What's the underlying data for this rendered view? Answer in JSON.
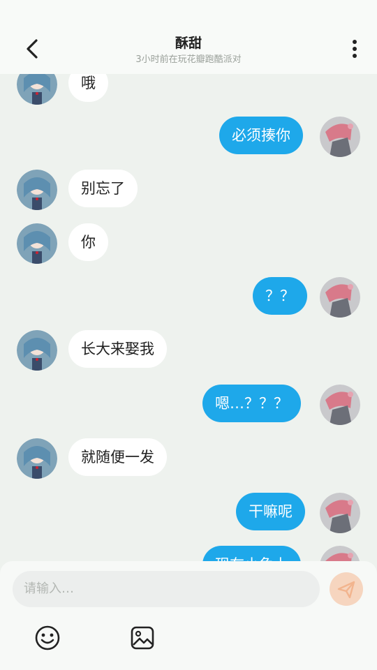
{
  "header": {
    "title": "酥甜",
    "subtitle": "3小时前在玩花瓣跑酷派对"
  },
  "messages": [
    {
      "side": "in",
      "text": "哦"
    },
    {
      "side": "out",
      "text": "必须揍你"
    },
    {
      "side": "in",
      "text": "别忘了"
    },
    {
      "side": "in",
      "text": "你"
    },
    {
      "side": "out",
      "text": "？？"
    },
    {
      "side": "in",
      "text": "长大来娶我"
    },
    {
      "side": "out",
      "text": "嗯…？？？"
    },
    {
      "side": "in",
      "text": "就随便一发"
    },
    {
      "side": "out",
      "text": "干嘛呢"
    },
    {
      "side": "out",
      "text": "现在小兔上"
    }
  ],
  "composer": {
    "placeholder": "请输入…",
    "icons": {
      "send": "send-icon",
      "emoji": "emoji-icon",
      "image": "image-icon"
    }
  },
  "colors": {
    "background": "#eef2ee",
    "outgoing_bubble": "#1ea8ea",
    "incoming_bubble": "#ffffff",
    "send_button": "#f6d5bf"
  }
}
